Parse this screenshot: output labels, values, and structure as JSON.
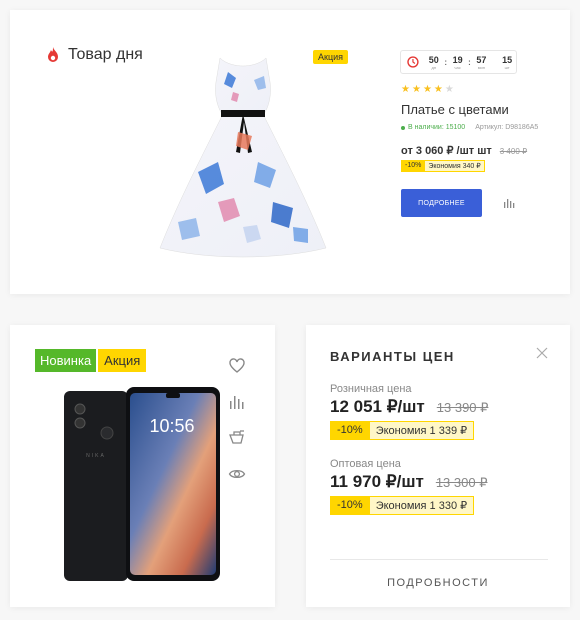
{
  "deal": {
    "title": "Товар дня",
    "sale_badge": "Акция",
    "timer": {
      "days": "50",
      "days_label": "дн",
      "hours": "19",
      "hours_label": "час",
      "minutes": "57",
      "minutes_label": "мин",
      "seconds": "15",
      "seconds_label": "шт"
    },
    "rating": 4,
    "rating_max": 5,
    "product_name": "Платье с цветами",
    "stock": "В наличии: 15100",
    "article": "Артикул: D98186A5",
    "price": "от 3 060 ₽ /шт шт",
    "old_price": "3 400 ₽",
    "discount_pct": "-10%",
    "saving": "Экономия 340 ₽",
    "more_button": "ПОДРОБНЕЕ",
    "icons": {
      "fire": "fire-icon",
      "clock": "clock-icon",
      "compare": "compare-icon"
    }
  },
  "product": {
    "badge_new": "Новинка",
    "badge_sale": "Акция",
    "icons": [
      "heart-icon",
      "compare-icon",
      "cart-icon",
      "eye-icon"
    ]
  },
  "prices": {
    "title": "ВАРИАНТЫ ЦЕН",
    "retail": {
      "label": "Розничная цена",
      "price": "12 051 ₽/шт",
      "old_price": "13 390 ₽",
      "discount_pct": "-10%",
      "saving": "Экономия 1 339 ₽"
    },
    "wholesale": {
      "label": "Оптовая цена",
      "price": "11 970 ₽/шт",
      "old_price": "13 300 ₽",
      "discount_pct": "-10%",
      "saving": "Экономия 1 330 ₽"
    },
    "details_link": "ПОДРОБНОСТИ"
  },
  "colors": {
    "accent_blue": "#3a5fd8",
    "badge_yellow": "#ffd600",
    "badge_green": "#55b82a",
    "fire_red": "#e53935",
    "star_gold": "#f9c020"
  }
}
